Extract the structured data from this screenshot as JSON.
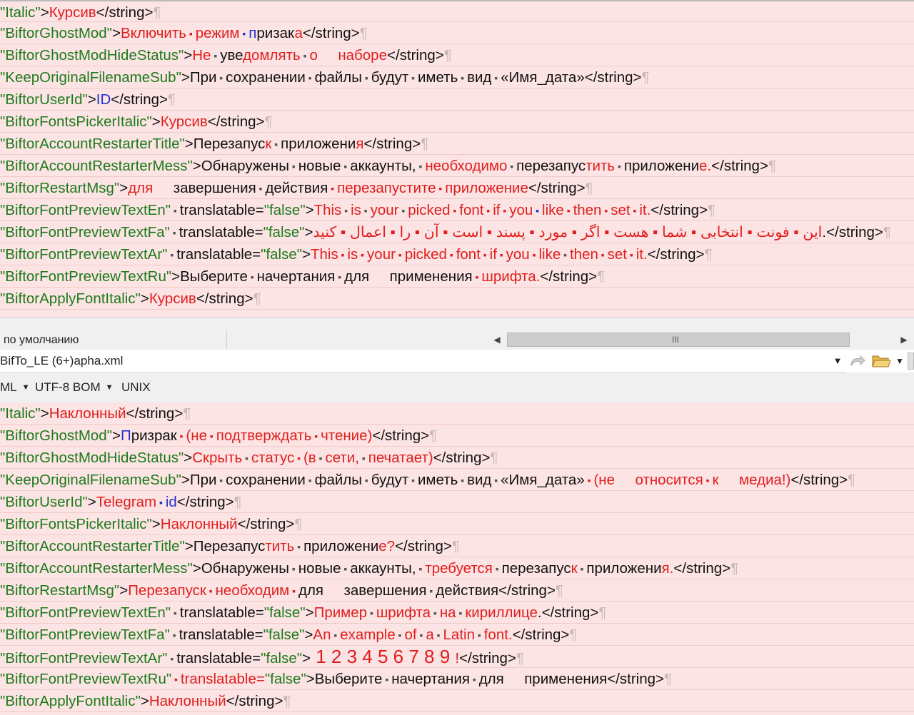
{
  "top_lines": [
    [
      [
        "g",
        "\"Italic\""
      ],
      [
        "k",
        ">"
      ],
      [
        "r",
        "Курсив"
      ],
      [
        "k",
        "</string>"
      ],
      [
        "pil",
        "¶"
      ]
    ],
    [
      [
        "g",
        "\"BiftorGhostMod\""
      ],
      [
        "k",
        ">"
      ],
      [
        "r",
        "Включить"
      ],
      [
        "rd",
        " ▪ "
      ],
      [
        "r",
        "режим"
      ],
      [
        "bd",
        " ▪ "
      ],
      [
        "b",
        "п"
      ],
      [
        "k",
        "ризак"
      ],
      [
        "r",
        "а"
      ],
      [
        "k",
        "</string>"
      ],
      [
        "pil",
        "¶"
      ]
    ],
    [
      [
        "g",
        "\"BiftorGhostModHideStatus\""
      ],
      [
        "k",
        ">"
      ],
      [
        "r",
        "Не"
      ],
      [
        "dot",
        " ▪ "
      ],
      [
        "k",
        "уве"
      ],
      [
        "r",
        "домлять"
      ],
      [
        "dot",
        " ▪ "
      ],
      [
        "r",
        "о     наборе"
      ],
      [
        "k",
        "</string>"
      ],
      [
        "pil",
        "¶"
      ]
    ],
    [
      [
        "g",
        "\"KeepOriginalFilenameSub\""
      ],
      [
        "k",
        ">При"
      ],
      [
        "dot",
        " ▪ "
      ],
      [
        "k",
        "сохранении"
      ],
      [
        "dot",
        " ▪ "
      ],
      [
        "k",
        "файлы"
      ],
      [
        "dot",
        " ▪ "
      ],
      [
        "k",
        "будут"
      ],
      [
        "dot",
        " ▪ "
      ],
      [
        "k",
        "иметь"
      ],
      [
        "dot",
        " ▪ "
      ],
      [
        "k",
        "вид"
      ],
      [
        "dot",
        " ▪ "
      ],
      [
        "k",
        "«Имя_дата»</string>"
      ],
      [
        "pil",
        "¶"
      ]
    ],
    [
      [
        "g",
        "\"BiftorUserId\""
      ],
      [
        "k",
        ">"
      ],
      [
        "b",
        "ID"
      ],
      [
        "k",
        "</string>"
      ],
      [
        "pil",
        "¶"
      ]
    ],
    [
      [
        "g",
        "\"BiftorFontsPickerItalic\""
      ],
      [
        "k",
        ">"
      ],
      [
        "r",
        "Курсив"
      ],
      [
        "k",
        "</string>"
      ],
      [
        "pil",
        "¶"
      ]
    ],
    [
      [
        "g",
        "\"BiftorAccountRestarterTitle\""
      ],
      [
        "k",
        ">Перезапус"
      ],
      [
        "r",
        "к"
      ],
      [
        "dot",
        " ▪ "
      ],
      [
        "k",
        "приложени"
      ],
      [
        "r",
        "я"
      ],
      [
        "k",
        "</string>"
      ],
      [
        "pil",
        "¶"
      ]
    ],
    [
      [
        "g",
        "\"BiftorAccountRestarterMess\""
      ],
      [
        "k",
        ">Обнаружены"
      ],
      [
        "dot",
        " ▪ "
      ],
      [
        "k",
        "новые"
      ],
      [
        "dot",
        " ▪ "
      ],
      [
        "k",
        "аккаунты,"
      ],
      [
        "dot",
        " ▪ "
      ],
      [
        "r",
        "необходимо"
      ],
      [
        "dot",
        " ▪ "
      ],
      [
        "k",
        "перезапус"
      ],
      [
        "r",
        "тить"
      ],
      [
        "dot",
        " ▪ "
      ],
      [
        "k",
        "приложени"
      ],
      [
        "r",
        "е."
      ],
      [
        "k",
        "</string>"
      ],
      [
        "pil",
        "¶"
      ]
    ],
    [
      [
        "g",
        "\"BiftorRestartMsg\""
      ],
      [
        "k",
        ">"
      ],
      [
        "r",
        "для"
      ],
      [
        "k",
        "     завершения"
      ],
      [
        "dot",
        " ▪ "
      ],
      [
        "k",
        "действия"
      ],
      [
        "rd",
        " ▪ "
      ],
      [
        "r",
        "перезапустите"
      ],
      [
        "rd",
        " ▪ "
      ],
      [
        "r",
        "приложение"
      ],
      [
        "k",
        "</string>"
      ],
      [
        "pil",
        "¶"
      ]
    ],
    [
      [
        "g",
        "\"BiftorFontPreviewTextEn\""
      ],
      [
        "dot",
        " ▪ "
      ],
      [
        "k",
        "translatable="
      ],
      [
        "g",
        "\"false\""
      ],
      [
        "k",
        ">"
      ],
      [
        "r",
        "This"
      ],
      [
        "dot",
        " ▪ "
      ],
      [
        "r",
        "is"
      ],
      [
        "dot",
        " ▪ "
      ],
      [
        "r",
        "your"
      ],
      [
        "dot",
        " ▪ "
      ],
      [
        "r",
        "picked"
      ],
      [
        "rd",
        " ▪ "
      ],
      [
        "r",
        "font"
      ],
      [
        "rd",
        " ▪ "
      ],
      [
        "r",
        "if"
      ],
      [
        "rd",
        " ▪ "
      ],
      [
        "r",
        "you"
      ],
      [
        "bd",
        " ▪ "
      ],
      [
        "r",
        "like"
      ],
      [
        "rd",
        " ▪ "
      ],
      [
        "r",
        "then"
      ],
      [
        "rd",
        " ▪ "
      ],
      [
        "r",
        "set"
      ],
      [
        "rd",
        " ▪ "
      ],
      [
        "r",
        "it."
      ],
      [
        "k",
        "</string>"
      ],
      [
        "pil",
        "¶"
      ]
    ],
    [
      [
        "g",
        "\"BiftorFontPreviewTextFa\""
      ],
      [
        "dot",
        " ▪ "
      ],
      [
        "k",
        "translatable="
      ],
      [
        "g",
        "\"false\""
      ],
      [
        "k",
        ">"
      ],
      [
        "r",
        "این ▪ فونت ▪ انتخابی ▪ شما ▪ هست ▪ اگر ▪ مورد ▪ پسند ▪ است ▪ آن ▪ را ▪ اعمال ▪ کنید"
      ],
      [
        "k",
        ".</string>"
      ],
      [
        "pil",
        "¶"
      ]
    ],
    [
      [
        "g",
        "\"BiftorFontPreviewTextAr\""
      ],
      [
        "dot",
        " ▪ "
      ],
      [
        "k",
        "translatable="
      ],
      [
        "g",
        "\"false\""
      ],
      [
        "k",
        ">"
      ],
      [
        "r",
        "This"
      ],
      [
        "rd",
        " ▪ "
      ],
      [
        "r",
        "is"
      ],
      [
        "rd",
        " ▪ "
      ],
      [
        "r",
        "your"
      ],
      [
        "rd",
        " ▪ "
      ],
      [
        "r",
        "picked"
      ],
      [
        "rd",
        " ▪ "
      ],
      [
        "r",
        "font"
      ],
      [
        "rd",
        " ▪ "
      ],
      [
        "r",
        "if"
      ],
      [
        "rd",
        " ▪ "
      ],
      [
        "r",
        "you"
      ],
      [
        "rd",
        " ▪ "
      ],
      [
        "r",
        "like"
      ],
      [
        "dot",
        " ▪ "
      ],
      [
        "r",
        "then"
      ],
      [
        "rd",
        " ▪ "
      ],
      [
        "r",
        "set"
      ],
      [
        "rd",
        " ▪ "
      ],
      [
        "r",
        "it."
      ],
      [
        "k",
        "</string>"
      ],
      [
        "pil",
        "¶"
      ]
    ],
    [
      [
        "g",
        "\"BiftorFontPreviewTextRu\""
      ],
      [
        "k",
        ">Выберите"
      ],
      [
        "dot",
        " ▪ "
      ],
      [
        "k",
        "начертания"
      ],
      [
        "dot",
        " ▪ "
      ],
      [
        "k",
        "для     применения"
      ],
      [
        "rd",
        " ▪ "
      ],
      [
        "r",
        "шрифта."
      ],
      [
        "k",
        "</string>"
      ],
      [
        "pil",
        "¶"
      ]
    ],
    [
      [
        "g",
        "\"BiftorApplyFontItalic\""
      ],
      [
        "k",
        ">"
      ],
      [
        "r",
        "Курсив"
      ],
      [
        "k",
        "</string>"
      ],
      [
        "pil",
        "¶"
      ]
    ]
  ],
  "status": {
    "left_label": "по умолчанию"
  },
  "scrollbar": {
    "left_arrow": "◀",
    "right_arrow": "▶",
    "grip": "III"
  },
  "file_bar": {
    "filename": "BifTo_LE (6+)apha.xml",
    "dropdown": "▼"
  },
  "format_bar": {
    "syntax": "ML",
    "encoding": "UTF-8 BOM",
    "line_endings": "UNIX"
  },
  "bottom_lines": [
    [
      [
        "g",
        "\"Italic\""
      ],
      [
        "k",
        ">"
      ],
      [
        "r",
        "Наклонный"
      ],
      [
        "k",
        "</string>"
      ],
      [
        "pil",
        "¶"
      ]
    ],
    [
      [
        "g",
        "\"BiftorGhostMod\""
      ],
      [
        "k",
        ">"
      ],
      [
        "b",
        "П"
      ],
      [
        "k",
        "ризрак"
      ],
      [
        "rd",
        " ▪ "
      ],
      [
        "r",
        "(не"
      ],
      [
        "rd",
        " ▪ "
      ],
      [
        "r",
        "подтверждать"
      ],
      [
        "rd",
        " ▪ "
      ],
      [
        "r",
        "чтение)"
      ],
      [
        "k",
        "</string>"
      ],
      [
        "pil",
        "¶"
      ]
    ],
    [
      [
        "g",
        "\"BiftorGhostModHideStatus\""
      ],
      [
        "k",
        ">"
      ],
      [
        "r",
        "Скрыть"
      ],
      [
        "dot",
        " ▪ "
      ],
      [
        "r",
        "статус"
      ],
      [
        "rd",
        " ▪ "
      ],
      [
        "r",
        "(в"
      ],
      [
        "dot",
        " ▪ "
      ],
      [
        "r",
        "сети,"
      ],
      [
        "dot",
        " ▪ "
      ],
      [
        "r",
        "печатает)"
      ],
      [
        "k",
        "</string>"
      ],
      [
        "pil",
        "¶"
      ]
    ],
    [
      [
        "g",
        "\"KeepOriginalFilenameSub\""
      ],
      [
        "k",
        ">При"
      ],
      [
        "dot",
        " ▪ "
      ],
      [
        "k",
        "сохранении"
      ],
      [
        "dot",
        " ▪ "
      ],
      [
        "k",
        "файлы"
      ],
      [
        "dot",
        " ▪ "
      ],
      [
        "k",
        "будут"
      ],
      [
        "dot",
        " ▪ "
      ],
      [
        "k",
        "иметь"
      ],
      [
        "dot",
        " ▪ "
      ],
      [
        "k",
        "вид"
      ],
      [
        "dot",
        " ▪ "
      ],
      [
        "k",
        "«Имя_дата»"
      ],
      [
        "rd",
        " ▪ "
      ],
      [
        "r",
        "(не     относится"
      ],
      [
        "rd",
        " ▪ "
      ],
      [
        "r",
        "к     медиа!)"
      ],
      [
        "k",
        "</string>"
      ],
      [
        "pil",
        "¶"
      ]
    ],
    [
      [
        "g",
        "\"BiftorUserId\""
      ],
      [
        "k",
        ">"
      ],
      [
        "r",
        "Telegram"
      ],
      [
        "bd",
        " ▪ "
      ],
      [
        "b",
        "id"
      ],
      [
        "k",
        "</string>"
      ],
      [
        "pil",
        "¶"
      ]
    ],
    [
      [
        "g",
        "\"BiftorFontsPickerItalic\""
      ],
      [
        "k",
        ">"
      ],
      [
        "r",
        "Наклонный"
      ],
      [
        "k",
        "</string>"
      ],
      [
        "pil",
        "¶"
      ]
    ],
    [
      [
        "g",
        "\"BiftorAccountRestarterTitle\""
      ],
      [
        "k",
        ">Перезапус"
      ],
      [
        "r",
        "тить"
      ],
      [
        "dot",
        " ▪ "
      ],
      [
        "k",
        "приложени"
      ],
      [
        "r",
        "е?"
      ],
      [
        "k",
        "</string>"
      ],
      [
        "pil",
        "¶"
      ]
    ],
    [
      [
        "g",
        "\"BiftorAccountRestarterMess\""
      ],
      [
        "k",
        ">Обнаружены"
      ],
      [
        "dot",
        " ▪ "
      ],
      [
        "k",
        "новые"
      ],
      [
        "dot",
        " ▪ "
      ],
      [
        "k",
        "аккаунты,"
      ],
      [
        "dot",
        " ▪ "
      ],
      [
        "r",
        "требуется"
      ],
      [
        "dot",
        " ▪ "
      ],
      [
        "k",
        "перезапус"
      ],
      [
        "r",
        "к"
      ],
      [
        "dot",
        " ▪ "
      ],
      [
        "k",
        "приложени"
      ],
      [
        "r",
        "я."
      ],
      [
        "k",
        "</string>"
      ],
      [
        "pil",
        "¶"
      ]
    ],
    [
      [
        "g",
        "\"BiftorRestartMsg\""
      ],
      [
        "k",
        ">"
      ],
      [
        "r",
        "Перезапуск"
      ],
      [
        "rd",
        " ▪ "
      ],
      [
        "r",
        "необходим"
      ],
      [
        "rd",
        " ▪ "
      ],
      [
        "k",
        "для     завершения"
      ],
      [
        "dot",
        " ▪ "
      ],
      [
        "k",
        "действия</string>"
      ],
      [
        "pil",
        "¶"
      ]
    ],
    [
      [
        "g",
        "\"BiftorFontPreviewTextEn\""
      ],
      [
        "dot",
        " ▪ "
      ],
      [
        "k",
        "translatable="
      ],
      [
        "g",
        "\"false\""
      ],
      [
        "k",
        ">"
      ],
      [
        "r",
        "Пример"
      ],
      [
        "dot",
        " ▪ "
      ],
      [
        "r",
        "шрифта"
      ],
      [
        "dot",
        " ▪ "
      ],
      [
        "r",
        "на"
      ],
      [
        "dot",
        " ▪ "
      ],
      [
        "r",
        "кириллице"
      ],
      [
        "k",
        ".</string>"
      ],
      [
        "pil",
        "¶"
      ]
    ],
    [
      [
        "g",
        "\"BiftorFontPreviewTextFa\""
      ],
      [
        "dot",
        " ▪ "
      ],
      [
        "k",
        "translatable="
      ],
      [
        "g",
        "\"false\""
      ],
      [
        "k",
        ">"
      ],
      [
        "r",
        "An"
      ],
      [
        "dot",
        " ▪ "
      ],
      [
        "r",
        "example"
      ],
      [
        "dot",
        " ▪ "
      ],
      [
        "r",
        "of"
      ],
      [
        "dot",
        " ▪ "
      ],
      [
        "r",
        "a"
      ],
      [
        "dot",
        " ▪ "
      ],
      [
        "r",
        "Latin"
      ],
      [
        "dot",
        " ▪ "
      ],
      [
        "r",
        "font."
      ],
      [
        "k",
        "</string>"
      ],
      [
        "pil",
        "¶"
      ]
    ],
    [
      [
        "g",
        "\"BiftorFontPreviewTextAr\""
      ],
      [
        "dot",
        " ▪ "
      ],
      [
        "k",
        "translatable="
      ],
      [
        "g",
        "\"false\""
      ],
      [
        "k",
        ">"
      ],
      [
        "r big",
        " 1 2 3 4 5 6 7 8 9 "
      ],
      [
        "r",
        "!"
      ],
      [
        "k",
        "</string>"
      ],
      [
        "pil",
        "¶"
      ]
    ],
    [
      [
        "g",
        "\"BiftorFontPreviewTextRu\""
      ],
      [
        "rd",
        " ▪ "
      ],
      [
        "r",
        "translatable="
      ],
      [
        "g",
        "\"false\""
      ],
      [
        "k",
        ">Выберите"
      ],
      [
        "dot",
        " ▪ "
      ],
      [
        "k",
        "начертания"
      ],
      [
        "dot",
        " ▪ "
      ],
      [
        "k",
        "для     применения</string>"
      ],
      [
        "pil",
        "¶"
      ]
    ],
    [
      [
        "g",
        "\"BiftorApplyFontItalic\""
      ],
      [
        "k",
        ">"
      ],
      [
        "r",
        "Наклонный"
      ],
      [
        "k",
        "</string>"
      ],
      [
        "pil",
        "¶"
      ]
    ]
  ]
}
